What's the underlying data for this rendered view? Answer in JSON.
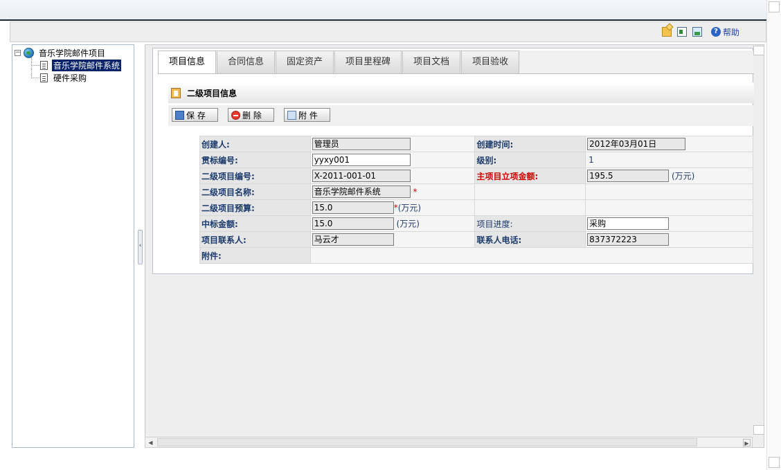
{
  "toolbar": {
    "icons": [
      "folder-icon",
      "exit-icon",
      "picture-icon",
      "help-icon"
    ],
    "help_label": "帮助"
  },
  "tree": {
    "root": "音乐学院邮件项目",
    "toggle": "−",
    "children": [
      "音乐学院邮件系统",
      "硬件采购"
    ]
  },
  "tabs": [
    {
      "label": "项目信息",
      "active": true
    },
    {
      "label": "合同信息",
      "active": false
    },
    {
      "label": "固定资产",
      "active": false
    },
    {
      "label": "项目里程碑",
      "active": false
    },
    {
      "label": "项目文档",
      "active": false
    },
    {
      "label": "项目验收",
      "active": false
    }
  ],
  "section": {
    "title": "二级项目信息"
  },
  "buttons": {
    "save": "保 存",
    "delete": "删 除",
    "attach": "附 件"
  },
  "form": {
    "creator_label": "创建人:",
    "creator_value": "管理员",
    "created_time_label": "创建时间:",
    "created_time_value": "2012年03月01日",
    "bid_no_label": "贯标编号:",
    "bid_no_value": "yyxy001",
    "level_label": "级别:",
    "level_value": "1",
    "sub_no_label": "二级项目编号:",
    "sub_no_value": "X-2011-001-01",
    "main_amount_label": "主项目立项金额:",
    "main_amount_value": "195.5",
    "sub_name_label": "二级项目名称:",
    "sub_name_value": "音乐学院邮件系统",
    "budget_label": "二级项目预算:",
    "budget_value": "15.0",
    "won_amount_label": "中标金额:",
    "won_amount_value": "15.0",
    "progress_label": "项目进度:",
    "progress_value": "采购",
    "contact_label": "项目联系人:",
    "contact_value": "马云才",
    "phone_label": "联系人电话:",
    "phone_value": "837372223",
    "attachment_label": "附件:",
    "unit": "(万元)",
    "required_mark": "*"
  },
  "colors": {
    "tree_selected_bg": "#0a246a",
    "label_text": "#1b3a6b",
    "required_red": "#d00000"
  }
}
